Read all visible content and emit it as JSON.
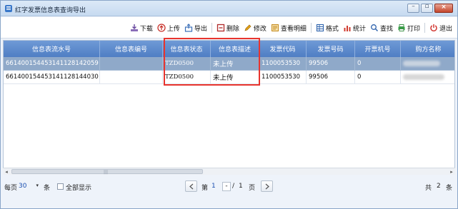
{
  "window": {
    "title": "红字发票信息表查询导出",
    "controls": [
      "minimize",
      "restore",
      "close"
    ]
  },
  "toolbar": {
    "items": [
      {
        "label": "下载",
        "icon": "download-icon"
      },
      {
        "label": "上传",
        "icon": "upload-icon"
      },
      {
        "label": "导出",
        "icon": "export-icon"
      },
      {
        "label": "删除",
        "icon": "delete-icon"
      },
      {
        "label": "修改",
        "icon": "edit-icon"
      },
      {
        "label": "查看明细",
        "icon": "view-detail-icon"
      },
      {
        "label": "格式",
        "icon": "format-icon"
      },
      {
        "label": "统计",
        "icon": "statistics-icon"
      },
      {
        "label": "查找",
        "icon": "search-icon"
      },
      {
        "label": "打印",
        "icon": "print-icon"
      },
      {
        "label": "退出",
        "icon": "exit-icon"
      }
    ]
  },
  "grid": {
    "columns": [
      "信息表流水号",
      "信息表编号",
      "信息表状态",
      "信息表描述",
      "发票代码",
      "发票号码",
      "开票机号",
      "购方名称"
    ],
    "rows": [
      {
        "serial": "661400154453141128142059",
        "number": "",
        "status": "TZD0500",
        "description": "未上传",
        "invoice_code": "1100053530",
        "invoice_number": "99506",
        "machine_no": "0",
        "buyer": "",
        "selected": true
      },
      {
        "serial": "661400154453141128144030",
        "number": "",
        "status": "TZD0500",
        "description": "未上传",
        "invoice_code": "1100053530",
        "invoice_number": "99506",
        "machine_no": "0",
        "buyer": "",
        "selected": false
      }
    ]
  },
  "footer": {
    "per_page_label": "每页",
    "page_size": "30",
    "unit": "条",
    "show_all_label": "全部显示",
    "page_prefix": "第",
    "current_page": "1",
    "slash": "/",
    "total_pages": "1",
    "page_suffix": "页",
    "total_prefix": "共",
    "total_count": "2",
    "total_suffix": "条"
  },
  "colors": {
    "header_bg": "#5a88cc",
    "selected_row": "#8fa9c9",
    "highlight_box": "#e8342e",
    "page_size_text": "#1a4fb0"
  }
}
